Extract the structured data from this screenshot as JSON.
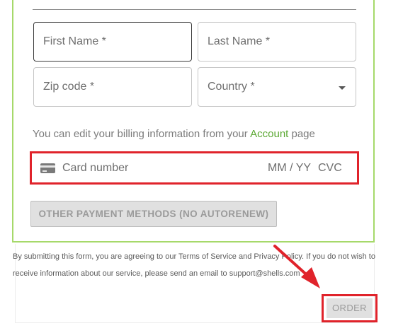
{
  "form": {
    "first_name_placeholder": "First Name *",
    "last_name_placeholder": "Last Name *",
    "zip_placeholder": "Zip code *",
    "country_placeholder": "Country *",
    "billing_note_prefix": "You can edit your billing information from your ",
    "billing_note_link": "Account",
    "billing_note_suffix": " page",
    "card_number_placeholder": "Card number",
    "card_exp_placeholder": "MM / YY",
    "card_cvc_placeholder": "CVC",
    "card_icon": "credit-card-icon",
    "other_payment_label": "OTHER PAYMENT METHODS (NO AUTORENEW)"
  },
  "terms": {
    "text_1": "By submitting this form, you are agreeing to our ",
    "tos_link": "Terms of Service",
    "text_2": " and ",
    "privacy_link": "Privacy Policy",
    "text_3": ". If you do not wish to receive information about our service, please send an email to support@shells.com"
  },
  "order": {
    "label": "ORDER"
  },
  "colors": {
    "panel_border": "#a6d96a",
    "highlight": "#e0232b",
    "link": "#5aa832",
    "button_bg": "#e0e0e0"
  }
}
